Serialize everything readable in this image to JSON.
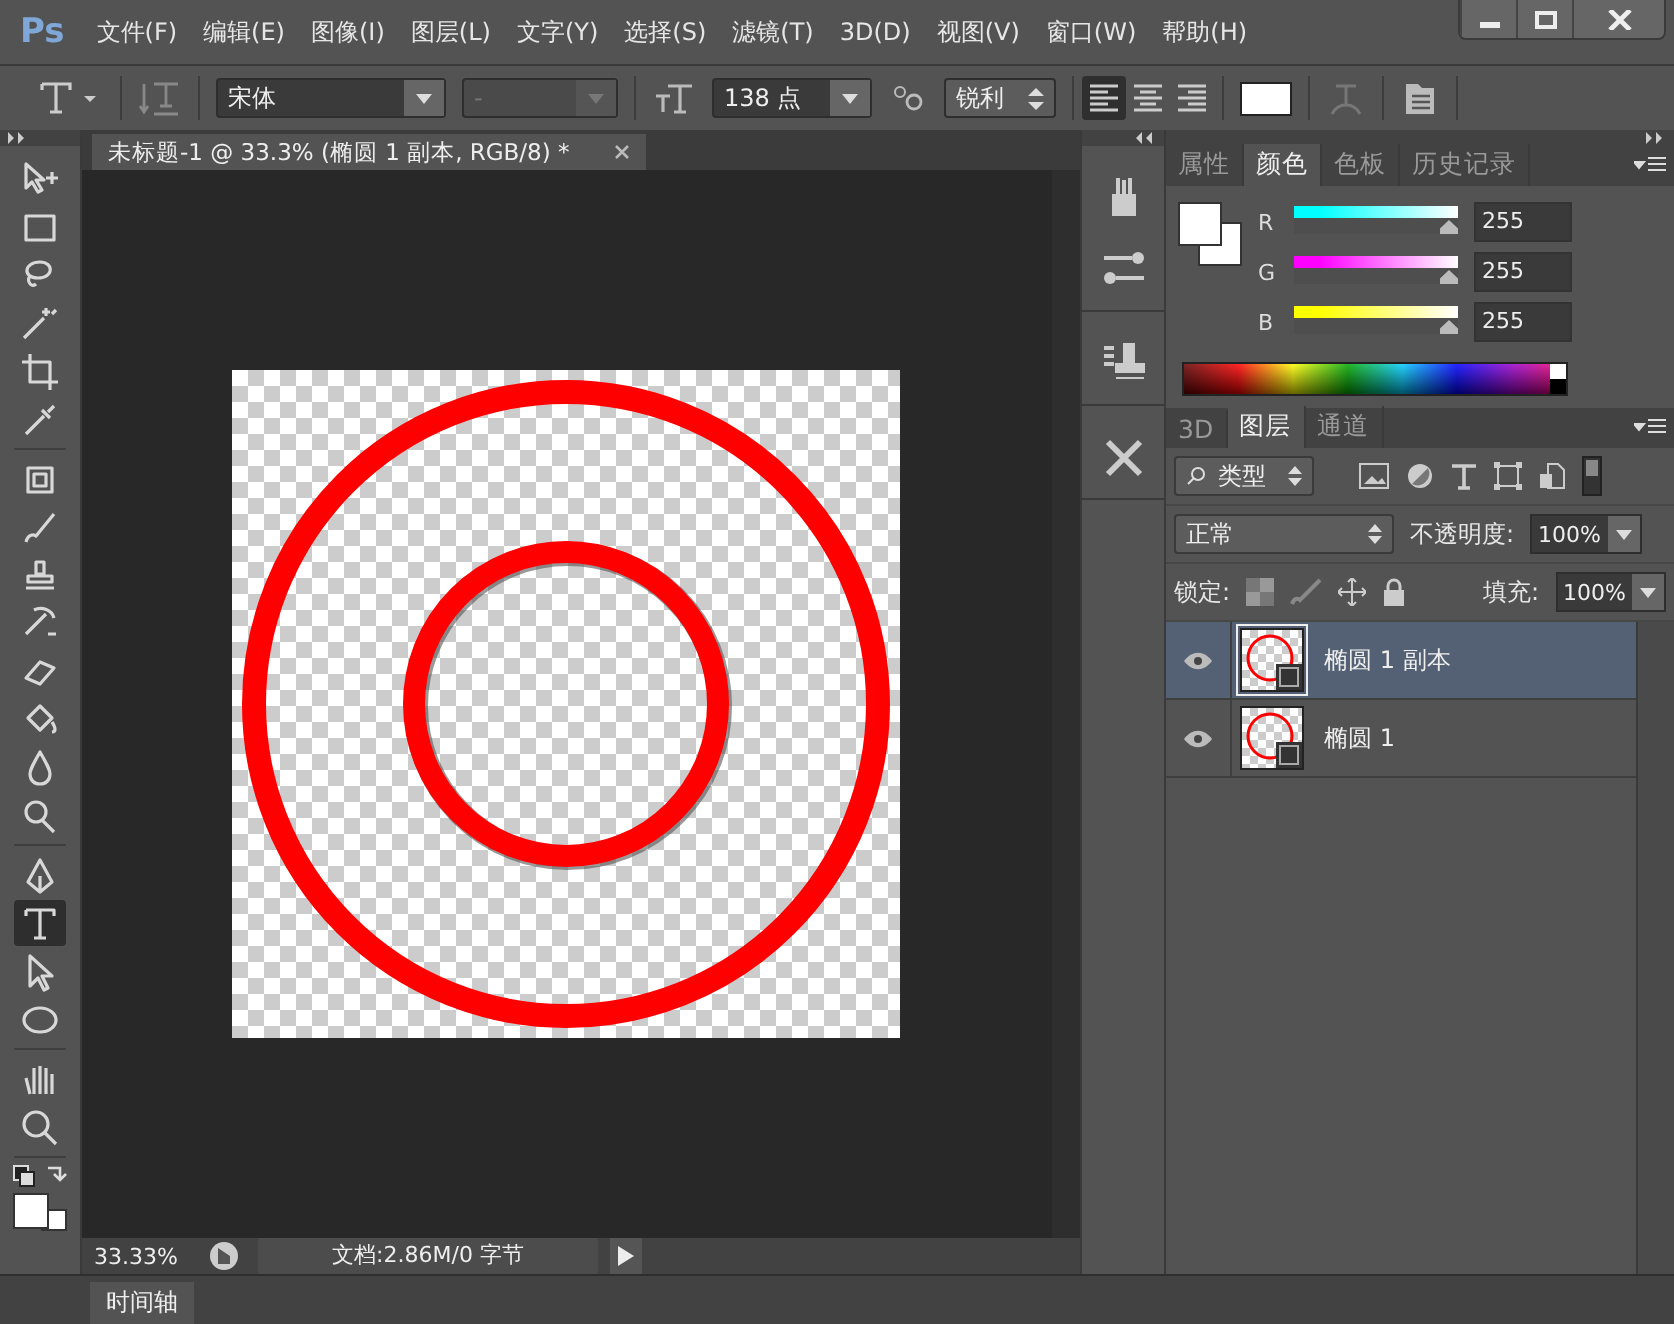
{
  "app": {
    "logo": "Ps"
  },
  "menu": [
    {
      "label": "文件(F)"
    },
    {
      "label": "编辑(E)"
    },
    {
      "label": "图像(I)"
    },
    {
      "label": "图层(L)"
    },
    {
      "label": "文字(Y)"
    },
    {
      "label": "选择(S)"
    },
    {
      "label": "滤镜(T)"
    },
    {
      "label": "3D(D)"
    },
    {
      "label": "视图(V)"
    },
    {
      "label": "窗口(W)"
    },
    {
      "label": "帮助(H)"
    }
  ],
  "options_bar": {
    "font_family": "宋体",
    "font_style": "-",
    "font_size": "138 点",
    "antialias": "锐利",
    "alignment": [
      {
        "kind": "left",
        "selected": true
      },
      {
        "kind": "center",
        "selected": false
      },
      {
        "kind": "right",
        "selected": false
      }
    ]
  },
  "document_tab": {
    "title": "未标题-1 @ 33.3% (椭圆 1 副本, RGB/8) *"
  },
  "tool_groups": [
    [
      {
        "kind": "move",
        "selected": false
      },
      {
        "kind": "marquee",
        "selected": false
      },
      {
        "kind": "lasso",
        "selected": false
      },
      {
        "kind": "wand",
        "selected": false
      },
      {
        "kind": "crop",
        "selected": false
      },
      {
        "kind": "eyedropper",
        "selected": false
      }
    ],
    [
      {
        "kind": "patch",
        "selected": false
      },
      {
        "kind": "brush",
        "selected": false
      },
      {
        "kind": "stamp",
        "selected": false
      },
      {
        "kind": "history",
        "selected": false
      },
      {
        "kind": "eraser",
        "selected": false
      },
      {
        "kind": "bucket",
        "selected": false
      },
      {
        "kind": "drop",
        "selected": false
      },
      {
        "kind": "dodge",
        "selected": false
      }
    ],
    [
      {
        "kind": "pen",
        "selected": false
      },
      {
        "kind": "type",
        "selected": true
      },
      {
        "kind": "pointer",
        "selected": false
      },
      {
        "kind": "ellipse",
        "selected": false
      }
    ],
    [
      {
        "kind": "hand",
        "selected": false
      },
      {
        "kind": "zoom",
        "selected": false
      }
    ]
  ],
  "color_panel": {
    "tabs": [
      {
        "label": "属性",
        "selected": false
      },
      {
        "label": "颜色",
        "selected": true
      },
      {
        "label": "色板",
        "selected": false
      },
      {
        "label": "历史记录",
        "selected": false
      }
    ],
    "channels": [
      {
        "label": "R",
        "value": "255",
        "level": 1,
        "color": "#00ffff"
      },
      {
        "label": "G",
        "value": "255",
        "level": 1,
        "color": "#ff00ff"
      },
      {
        "label": "B",
        "value": "255",
        "level": 1,
        "color": "#ffff00"
      }
    ]
  },
  "layers_panel": {
    "tabs": [
      {
        "label": "3D",
        "selected": false
      },
      {
        "label": "图层",
        "selected": true
      },
      {
        "label": "通道",
        "selected": false
      }
    ],
    "filter": "类型",
    "blend_mode": "正常",
    "opacity_label": "不透明度:",
    "opacity": "100%",
    "lock_label": "锁定:",
    "fill_label": "填充:",
    "fill": "100%",
    "layers": [
      {
        "name": "椭圆 1 副本",
        "selected": true,
        "visible": true
      },
      {
        "name": "椭圆 1",
        "selected": false,
        "visible": true
      }
    ]
  },
  "status_bar": {
    "zoom": "33.33%",
    "doc_info": "文档:2.86M/0 字节"
  },
  "timeline": {
    "tab": "时间轴"
  }
}
